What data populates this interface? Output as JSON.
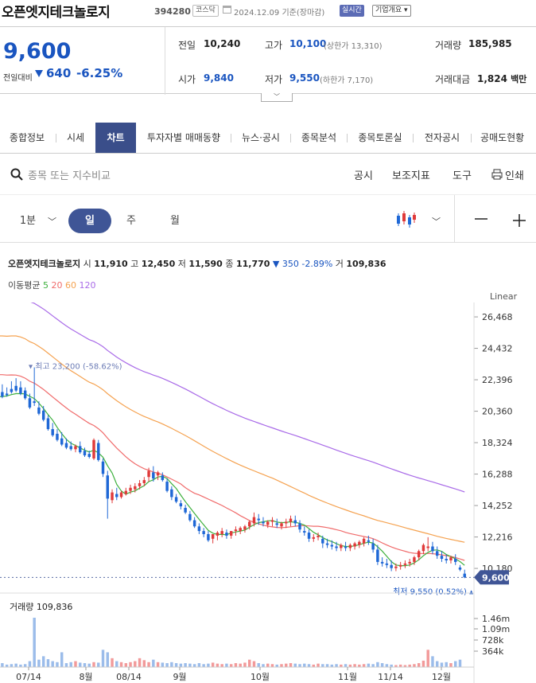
{
  "stock": {
    "name": "오픈엣지테크놀로지",
    "code": "394280",
    "market": "코스닥",
    "date": "2024.12.09",
    "basis": "기준(장마감)",
    "realtime": "실시간",
    "corp_info": "기업개요"
  },
  "quote": {
    "price": "9,600",
    "prev_label": "전일대비",
    "change": "640",
    "change_pct": "-6.25%",
    "prev_close_label": "전일",
    "prev_close": "10,240",
    "high_label": "고가",
    "high": "10,100",
    "upper_limit": "(상한가 13,310)",
    "volume_label": "거래량",
    "volume": "185,985",
    "open_label": "시가",
    "open": "9,840",
    "low_label": "저가",
    "low": "9,550",
    "lower_limit": "(하한가 7,170)",
    "amount_label": "거래대금",
    "amount": "1,824",
    "amount_unit": "백만"
  },
  "tabs": [
    "종합정보",
    "시세",
    "차트",
    "투자자별 매매동향",
    "뉴스·공시",
    "종목분석",
    "종목토론실",
    "전자공시",
    "공매도현황"
  ],
  "search": {
    "placeholder": "종목 또는 지수비교",
    "tools": [
      "공시",
      "보조지표",
      "도구",
      "인쇄"
    ]
  },
  "period": {
    "minute": "1분",
    "day": "일",
    "week": "주",
    "month": "월"
  },
  "legend": {
    "name": "오픈엣지테크놀로지",
    "o_l": "시",
    "o": "11,910",
    "h_l": "고",
    "h": "12,450",
    "l_l": "저",
    "l": "11,590",
    "c_l": "종",
    "c": "11,770",
    "chg": "▼ 350 -2.89%",
    "v_l": "거",
    "v": "109,836",
    "ma_label": "이동평균",
    "ma5": "5",
    "ma20": "20",
    "ma60": "60",
    "ma120": "120",
    "scale": "Linear"
  },
  "colors": {
    "up": "#e03a3a",
    "down": "#1f68d6",
    "ma5": "#3db03d",
    "ma20": "#f06b6b",
    "ma60": "#f5a250",
    "ma120": "#a96be8",
    "accent": "#3a4e8a"
  },
  "chart_data": {
    "type": "candlestick",
    "y_ticks": [
      26468,
      24432,
      22396,
      20360,
      18324,
      16288,
      14252,
      12216,
      10180
    ],
    "ylim": [
      9100,
      27400
    ],
    "current_price_label": "9,600",
    "max_label": "최고 23,200 (-58.62%)",
    "min_label": "최저 9,550 (0.52%)",
    "x_labels": [
      "07/14",
      "8월",
      "08/14",
      "9월",
      "10월",
      "11월",
      "11/14",
      "12월"
    ],
    "candles": [
      [
        21600,
        22100,
        21300,
        21200
      ],
      [
        21500,
        21900,
        21400,
        21300
      ],
      [
        21800,
        22300,
        21600,
        21500
      ],
      [
        22000,
        22500,
        21700,
        21600
      ],
      [
        21900,
        22300,
        21500,
        21400
      ],
      [
        21700,
        21900,
        21200,
        21100
      ],
      [
        21200,
        21500,
        20600,
        20500
      ],
      [
        21000,
        23200,
        20900,
        20700
      ],
      [
        20600,
        21000,
        20200,
        20100
      ],
      [
        20400,
        20700,
        19800,
        19700
      ],
      [
        19900,
        20100,
        19200,
        19100
      ],
      [
        19200,
        19600,
        18800,
        18700
      ],
      [
        18900,
        19200,
        18500,
        18400
      ],
      [
        18600,
        19000,
        18200,
        18100
      ],
      [
        18300,
        18600,
        18000,
        17900
      ],
      [
        18100,
        18400,
        17900,
        17800
      ],
      [
        17900,
        18200,
        18100,
        17700
      ],
      [
        18100,
        18400,
        17700,
        17600
      ],
      [
        17800,
        18000,
        17500,
        17400
      ],
      [
        17600,
        17800,
        17400,
        17300
      ],
      [
        17300,
        18600,
        18500,
        17200
      ],
      [
        18300,
        18500,
        17200,
        17100
      ],
      [
        17100,
        17300,
        16300,
        16100
      ],
      [
        16200,
        16500,
        14700,
        13400
      ],
      [
        14600,
        15300,
        15100,
        14400
      ],
      [
        15000,
        15400,
        14800,
        14600
      ],
      [
        14800,
        15200,
        15100,
        14700
      ],
      [
        15000,
        15400,
        15200,
        14900
      ],
      [
        15200,
        15600,
        15400,
        15000
      ],
      [
        15300,
        15700,
        15500,
        15100
      ],
      [
        15500,
        15900,
        15700,
        15300
      ],
      [
        15700,
        16100,
        15900,
        15500
      ],
      [
        16100,
        16700,
        16500,
        15800
      ],
      [
        16400,
        16800,
        16000,
        15800
      ],
      [
        16200,
        16500,
        16400,
        15900
      ],
      [
        16200,
        16400,
        15900,
        15800
      ],
      [
        15800,
        16000,
        15200,
        15100
      ],
      [
        15300,
        15500,
        14800,
        14600
      ],
      [
        14800,
        15000,
        14500,
        14400
      ],
      [
        14400,
        14600,
        14200,
        14000
      ],
      [
        14100,
        14300,
        13800,
        13700
      ],
      [
        13700,
        13900,
        13300,
        13200
      ],
      [
        13300,
        13500,
        12900,
        12800
      ],
      [
        12900,
        13100,
        12600,
        12400
      ],
      [
        12600,
        12800,
        12400,
        12200
      ],
      [
        12400,
        12600,
        12000,
        11900
      ],
      [
        12100,
        12300,
        12400,
        11800
      ],
      [
        12300,
        12600,
        12500,
        12000
      ],
      [
        12400,
        12800,
        12600,
        12200
      ],
      [
        12500,
        12700,
        12300,
        12100
      ],
      [
        12300,
        12600,
        12600,
        12100
      ],
      [
        12600,
        12900,
        12700,
        12300
      ],
      [
        12600,
        12900,
        12800,
        12400
      ],
      [
        12700,
        13000,
        12900,
        12500
      ],
      [
        12900,
        13300,
        13200,
        12700
      ],
      [
        13100,
        13800,
        13500,
        12900
      ],
      [
        13400,
        13700,
        13300,
        13000
      ],
      [
        13200,
        13500,
        13100,
        12900
      ],
      [
        13000,
        13300,
        13200,
        12800
      ],
      [
        13200,
        13500,
        13300,
        12900
      ],
      [
        13100,
        13400,
        13000,
        12800
      ],
      [
        12900,
        13200,
        13100,
        12700
      ],
      [
        13100,
        13400,
        13200,
        12800
      ],
      [
        13200,
        13600,
        13400,
        12900
      ],
      [
        13300,
        13600,
        13100,
        12900
      ],
      [
        13100,
        13300,
        12700,
        12500
      ],
      [
        12600,
        12900,
        12500,
        12300
      ],
      [
        12500,
        12700,
        12100,
        11900
      ],
      [
        12100,
        12400,
        12200,
        11900
      ],
      [
        12200,
        12500,
        12300,
        12000
      ],
      [
        12100,
        12300,
        11800,
        11500
      ],
      [
        11800,
        12100,
        11700,
        11500
      ],
      [
        11700,
        12000,
        11600,
        11400
      ],
      [
        11600,
        11900,
        11500,
        11300
      ],
      [
        11500,
        11800,
        11700,
        11300
      ],
      [
        11600,
        11900,
        11500,
        11300
      ],
      [
        11500,
        11800,
        11700,
        11300
      ],
      [
        11600,
        11900,
        11800,
        11400
      ],
      [
        11700,
        12000,
        11900,
        11500
      ],
      [
        11800,
        12200,
        12100,
        11600
      ],
      [
        12000,
        12300,
        11900,
        11700
      ],
      [
        11800,
        12100,
        11400,
        11200
      ],
      [
        11400,
        11700,
        10600,
        10400
      ],
      [
        10600,
        10900,
        10500,
        10300
      ],
      [
        10500,
        10800,
        10400,
        10200
      ],
      [
        10400,
        10700,
        10200,
        10000
      ],
      [
        10200,
        10500,
        10300,
        10000
      ],
      [
        10300,
        10600,
        10400,
        10100
      ],
      [
        10400,
        10700,
        10500,
        10200
      ],
      [
        10500,
        10800,
        10600,
        10300
      ],
      [
        10600,
        11000,
        10900,
        10400
      ],
      [
        10900,
        11400,
        11300,
        10700
      ],
      [
        11300,
        11800,
        11700,
        11100
      ],
      [
        11500,
        12200,
        11600,
        11300
      ],
      [
        11600,
        11900,
        11300,
        11100
      ],
      [
        11300,
        11600,
        11000,
        10800
      ],
      [
        11000,
        11300,
        10800,
        10600
      ],
      [
        10800,
        11100,
        10700,
        10500
      ],
      [
        10700,
        11000,
        10900,
        10500
      ],
      [
        10800,
        11100,
        10600,
        10400
      ],
      [
        10240,
        10400,
        10100,
        10000
      ],
      [
        9840,
        10100,
        9600,
        9550
      ]
    ],
    "volume": [
      0.08,
      0.05,
      0.06,
      0.07,
      0.05,
      0.06,
      0.12,
      1.0,
      0.15,
      0.22,
      0.16,
      0.12,
      0.1,
      0.3,
      0.08,
      0.1,
      0.12,
      0.09,
      0.08,
      0.07,
      0.1,
      0.09,
      0.35,
      0.3,
      0.18,
      0.12,
      0.1,
      0.08,
      0.1,
      0.12,
      0.18,
      0.14,
      0.1,
      0.15,
      0.1,
      0.09,
      0.08,
      0.1,
      0.08,
      0.07,
      0.08,
      0.07,
      0.06,
      0.08,
      0.06,
      0.07,
      0.09,
      0.07,
      0.06,
      0.07,
      0.06,
      0.08,
      0.07,
      0.09,
      0.15,
      0.12,
      0.08,
      0.06,
      0.07,
      0.06,
      0.05,
      0.06,
      0.07,
      0.08,
      0.07,
      0.06,
      0.07,
      0.06,
      0.05,
      0.07,
      0.06,
      0.06,
      0.05,
      0.06,
      0.05,
      0.06,
      0.05,
      0.06,
      0.05,
      0.06,
      0.07,
      0.06,
      0.1,
      0.08,
      0.06,
      0.05,
      0.04,
      0.05,
      0.04,
      0.05,
      0.06,
      0.08,
      0.13,
      0.35,
      0.22,
      0.12,
      0.09,
      0.1,
      0.08,
      0.12,
      0.15
    ],
    "volume_label": "거래량 109,836",
    "volume_ticks": [
      "1.46m",
      "1.09m",
      "728k",
      "364k"
    ]
  }
}
